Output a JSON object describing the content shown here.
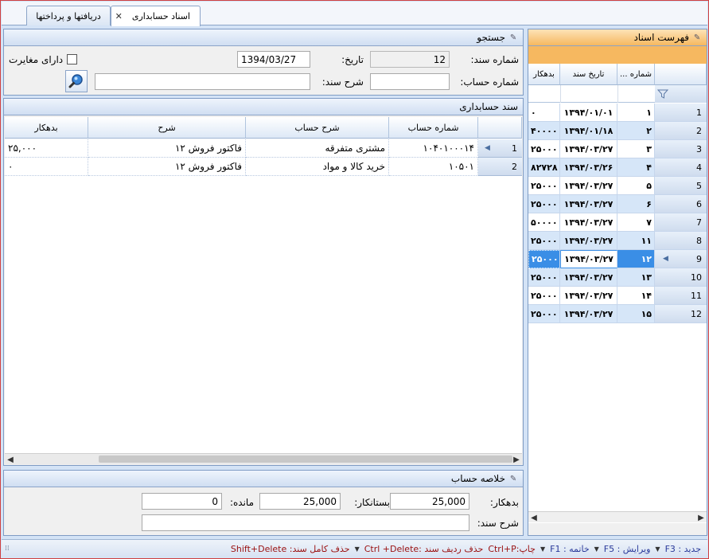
{
  "tabs": [
    {
      "label": "اسناد حسابداری",
      "active": true
    },
    {
      "label": "دریافتها و پرداختها",
      "active": false
    }
  ],
  "search": {
    "title": "جستجو",
    "doc_number_label": "شماره سند:",
    "doc_number_value": "12",
    "date_label": "تاریخ:",
    "date_value": "1394/03/27",
    "discrepancy_label": "دارای مغایرت",
    "account_number_label": "شماره حساب:",
    "account_number_value": "",
    "description_label": "شرح سند:",
    "description_value": ""
  },
  "voucher": {
    "title": "سند حسابداری",
    "columns": [
      "شماره حساب",
      "شرح حساب",
      "شرح",
      "بدهکار"
    ],
    "rows": [
      {
        "index": "1",
        "account": "۱۰۴۰۱۰۰۰۱۴",
        "account_desc": "مشتری متفرقه",
        "desc": "فاکتور فروش ۱۲",
        "debit": "۲۵,۰۰۰"
      },
      {
        "index": "2",
        "account": "۱۰۵۰۱",
        "account_desc": "خرید کالا و مواد",
        "desc": "فاکتور فروش ۱۲",
        "debit": "۰"
      }
    ]
  },
  "summary": {
    "title": "خلاصه حساب",
    "debit_label": "بدهکار:",
    "debit_value": "25,000",
    "credit_label": "بستانکار:",
    "credit_value": "25,000",
    "balance_label": "مانده:",
    "balance_value": "0",
    "description_label": "شرح سند:",
    "description_value": ""
  },
  "doclist": {
    "title": "فهرست اسناد",
    "columns": [
      "شماره ...",
      "تاریخ سند",
      "بدهکار"
    ],
    "rows": [
      {
        "index": "1",
        "num": "۱",
        "date": "۱۳۹۴/۰۱/۰۱",
        "debit": "۰"
      },
      {
        "index": "2",
        "num": "۲",
        "date": "۱۳۹۴/۰۱/۱۸",
        "debit": "۴۰۰۰۰"
      },
      {
        "index": "3",
        "num": "۳",
        "date": "۱۳۹۴/۰۳/۲۷",
        "debit": "۲۵۰۰۰"
      },
      {
        "index": "4",
        "num": "۴",
        "date": "۱۳۹۴/۰۳/۲۶",
        "debit": "۸۲۷۲۸"
      },
      {
        "index": "5",
        "num": "۵",
        "date": "۱۳۹۴/۰۳/۲۷",
        "debit": "۲۵۰۰۰"
      },
      {
        "index": "6",
        "num": "۶",
        "date": "۱۳۹۴/۰۳/۲۷",
        "debit": "۲۵۰۰۰"
      },
      {
        "index": "7",
        "num": "۷",
        "date": "۱۳۹۴/۰۳/۲۷",
        "debit": "۵۰۰۰۰"
      },
      {
        "index": "8",
        "num": "۱۱",
        "date": "۱۳۹۴/۰۳/۲۷",
        "debit": "۲۵۰۰۰"
      },
      {
        "index": "9",
        "num": "۱۲",
        "date": "۱۳۹۴/۰۳/۲۷",
        "debit": "۲۵۰۰۰"
      },
      {
        "index": "10",
        "num": "۱۳",
        "date": "۱۳۹۴/۰۳/۲۷",
        "debit": "۲۵۰۰۰"
      },
      {
        "index": "11",
        "num": "۱۴",
        "date": "۱۳۹۴/۰۳/۲۷",
        "debit": "۲۵۰۰۰"
      },
      {
        "index": "12",
        "num": "۱۵",
        "date": "۱۳۹۴/۰۳/۲۷",
        "debit": "۲۵۰۰۰"
      }
    ]
  },
  "statusbar": {
    "new": "جدید : F3",
    "edit": "ویرایش : F5",
    "close": "خاتمه : F1",
    "print": "چاپ:Ctrl+P",
    "delete_row": "حذف ردیف سند :Ctrl +Delete",
    "delete_doc": "حذف کامل سند: Shift+Delete"
  },
  "colors": {
    "selected_row": "#3a8ee6",
    "list_header": "#f6b860",
    "frame_border": "#d04040"
  }
}
